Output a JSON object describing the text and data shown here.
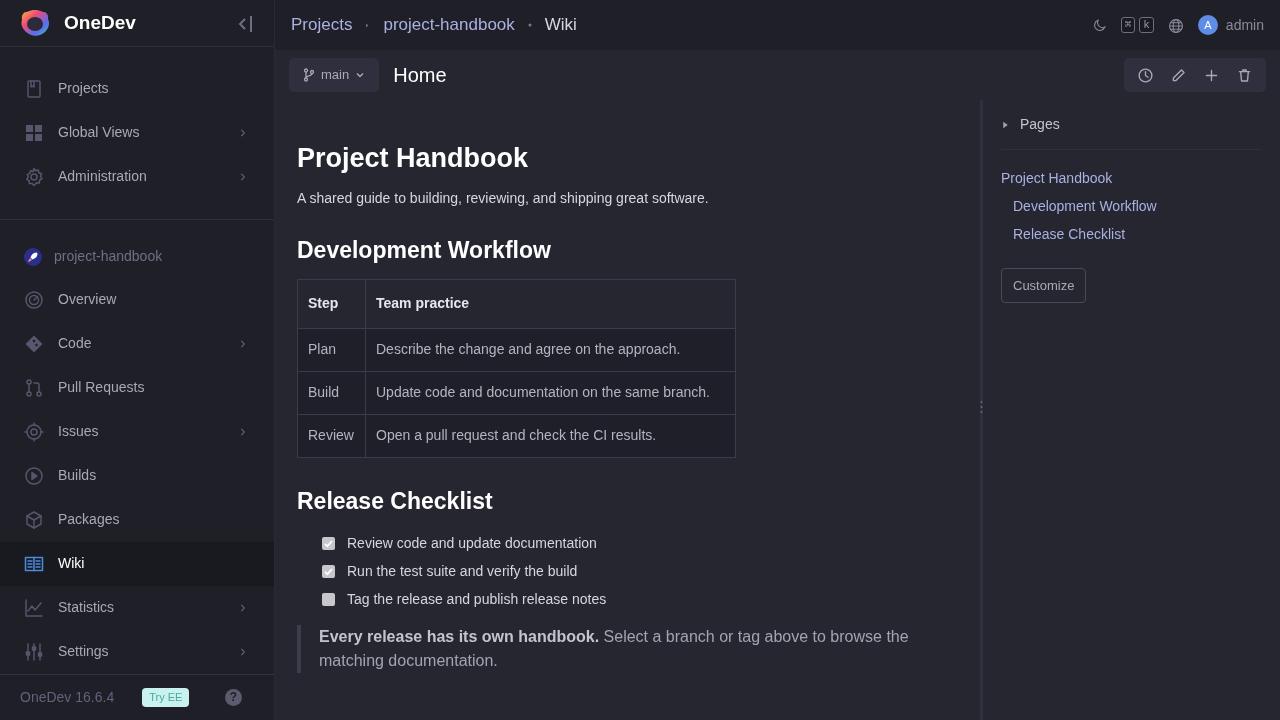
{
  "brand": {
    "name": "OneDev"
  },
  "global_nav": [
    {
      "label": "Projects",
      "has_submenu": false,
      "selected": false
    },
    {
      "label": "Global Views",
      "has_submenu": true,
      "selected": false
    },
    {
      "label": "Administration",
      "has_submenu": true,
      "selected": false
    }
  ],
  "project": {
    "name": "project-handbook"
  },
  "project_nav": [
    {
      "label": "Overview",
      "has_submenu": false,
      "selected": false
    },
    {
      "label": "Code",
      "has_submenu": true,
      "selected": false
    },
    {
      "label": "Pull Requests",
      "has_submenu": false,
      "selected": false
    },
    {
      "label": "Issues",
      "has_submenu": true,
      "selected": false
    },
    {
      "label": "Builds",
      "has_submenu": false,
      "selected": false
    },
    {
      "label": "Packages",
      "has_submenu": false,
      "selected": false
    },
    {
      "label": "Wiki",
      "has_submenu": false,
      "selected": true
    },
    {
      "label": "Statistics",
      "has_submenu": true,
      "selected": false
    },
    {
      "label": "Settings",
      "has_submenu": true,
      "selected": false
    }
  ],
  "sidebar_footer": {
    "version": "OneDev 16.6.4",
    "badge": "Try EE",
    "help": "?"
  },
  "breadcrumbs": [
    "Projects",
    "project-handbook",
    "Wiki"
  ],
  "topbar": {
    "shortcut_keys": [
      "⌘",
      "k"
    ],
    "avatar": "A",
    "user": "admin"
  },
  "toolbar": {
    "branch": "main",
    "page_title": "Home"
  },
  "article": {
    "title": "Project Handbook",
    "intro": "A shared guide to building, reviewing, and shipping great software.",
    "section_1": "Development Workflow",
    "table": {
      "columns": [
        "Step",
        "Team practice"
      ],
      "rows": [
        [
          "Plan",
          "Describe the change and agree on the approach."
        ],
        [
          "Build",
          "Update code and documentation on the same branch."
        ],
        [
          "Review",
          "Open a pull request and check the CI results."
        ]
      ]
    },
    "section_2": "Release Checklist",
    "checklist": [
      {
        "label": "Review code and update documentation",
        "checked": true
      },
      {
        "label": "Run the test suite and verify the build",
        "checked": true
      },
      {
        "label": "Tag the release and publish release notes",
        "checked": false
      }
    ],
    "note": "**Every release has its own handbook.** Select a branch or tag above to browse the matching documentation."
  },
  "side_panel": {
    "pages": {
      "label": "Pages",
      "expanded": false
    },
    "toc": [
      {
        "label": "Project Handbook",
        "children": [
          {
            "label": "Development Workflow"
          },
          {
            "label": "Release Checklist"
          }
        ]
      }
    ],
    "customize": "Customize"
  }
}
